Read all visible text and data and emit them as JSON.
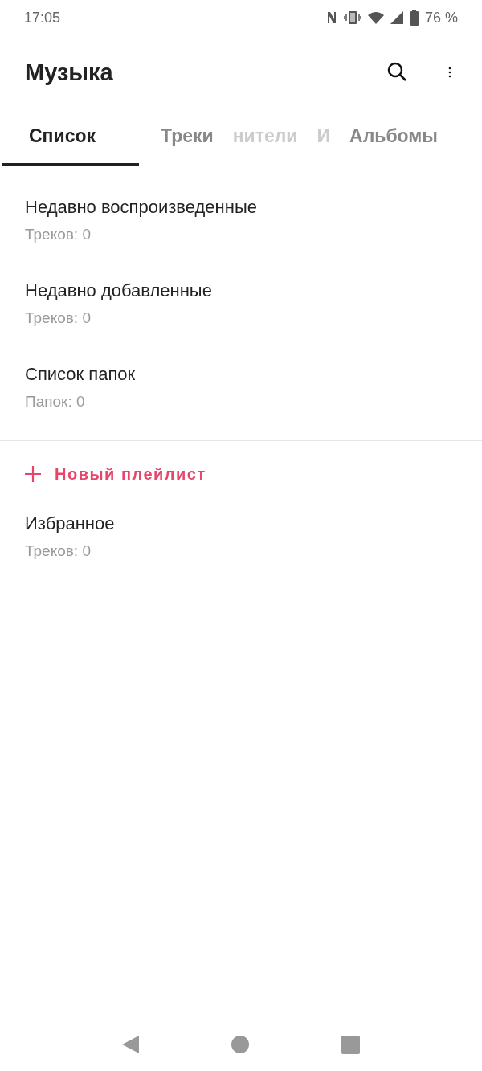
{
  "status_bar": {
    "time": "17:05",
    "battery": "76 %"
  },
  "app_bar": {
    "title": "Музыка"
  },
  "tabs": [
    {
      "label": "Список",
      "selected": true,
      "faded": false
    },
    {
      "label": "Треки",
      "selected": false,
      "faded": false
    },
    {
      "label": "нители",
      "selected": false,
      "faded": true
    },
    {
      "label": "И",
      "selected": false,
      "faded": true
    },
    {
      "label": "Альбомы",
      "selected": false,
      "faded": false
    }
  ],
  "library": [
    {
      "title": "Недавно воспроизведенные",
      "subtitle": "Треков: 0"
    },
    {
      "title": "Недавно добавленные",
      "subtitle": "Треков: 0"
    },
    {
      "title": "Список папок",
      "subtitle": "Папок: 0"
    }
  ],
  "new_playlist": {
    "label": "Новый плейлист"
  },
  "playlists": [
    {
      "title": "Избранное",
      "subtitle": "Треков: 0"
    }
  ]
}
